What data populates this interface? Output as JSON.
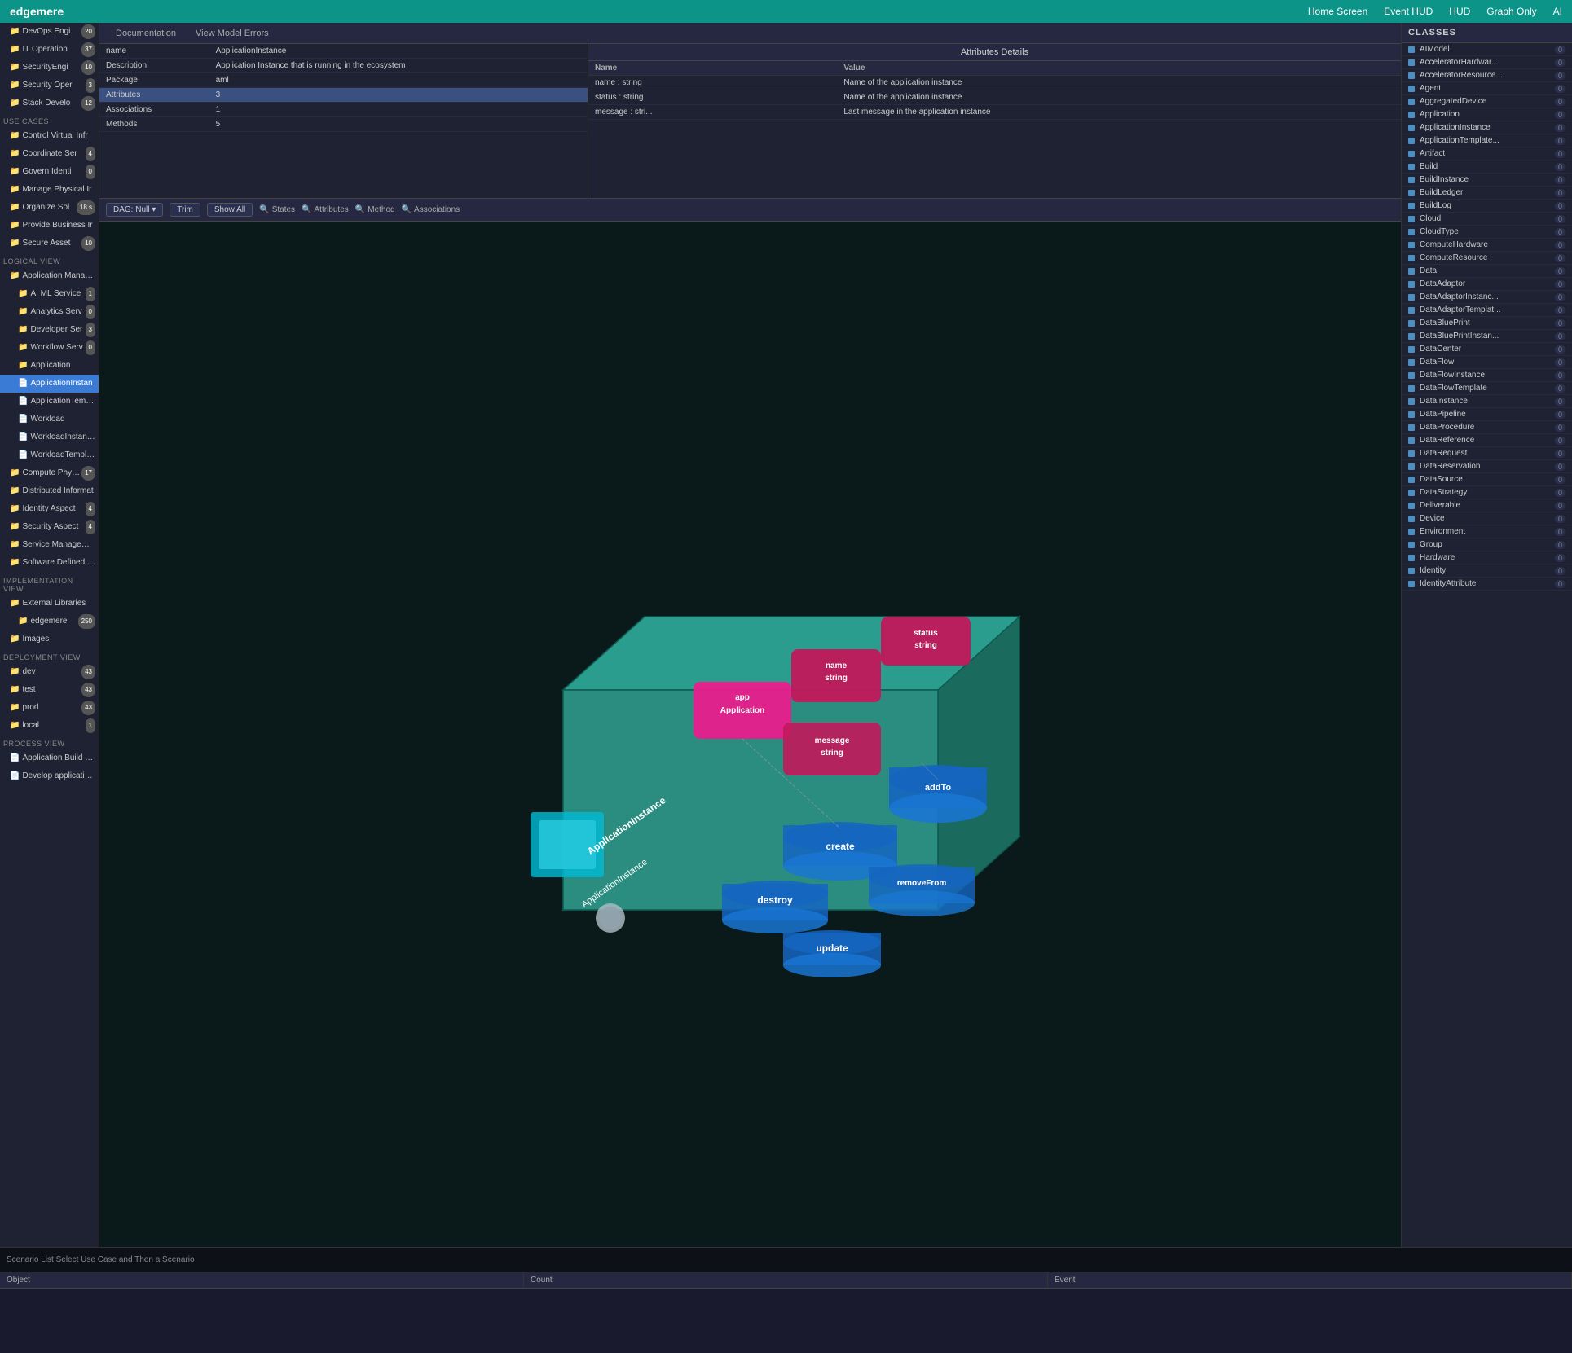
{
  "app": {
    "logo": "edgemere",
    "nav": [
      "Home Screen",
      "Event HUD",
      "HUD",
      "Graph Only",
      "AI"
    ]
  },
  "tabs": [
    {
      "label": "Documentation",
      "active": false
    },
    {
      "label": "View Model Errors",
      "active": false
    }
  ],
  "attributes_panel": {
    "title": "Attributes Details",
    "left_table": {
      "rows": [
        {
          "field": "name",
          "value": "ApplicationInstance"
        },
        {
          "field": "Description",
          "value": "Application Instance that is running in the ecosystem"
        },
        {
          "field": "Package",
          "value": "aml"
        },
        {
          "field": "Attributes",
          "value": "3",
          "highlight": true,
          "selected": true
        },
        {
          "field": "Associations",
          "value": "1"
        },
        {
          "field": "Methods",
          "value": "5"
        }
      ]
    },
    "right_table": {
      "cols": [
        "Name",
        "Value"
      ],
      "rows": [
        {
          "name": "name : string",
          "value": "Name of the application instance"
        },
        {
          "name": "status : string",
          "value": "Name of the application instance"
        },
        {
          "name": "message : stri...",
          "value": "Last message in the application instance"
        }
      ]
    }
  },
  "toolbar": {
    "dag_label": "DAG: Null ▾",
    "trim_label": "Trim",
    "show_all_label": "Show All",
    "states_label": "States",
    "attributes_label": "Attributes",
    "method_label": "Method",
    "associations_label": "Associations"
  },
  "viz": {
    "box_color": "#2a9d8f",
    "label": "ApplicationInstance",
    "app_label": "app\nApplication",
    "name_label": "name\nstring",
    "status_label": "status\nstring",
    "message_label": "message\nstring",
    "methods": [
      "addTo",
      "create",
      "removeFrom",
      "destroy",
      "update"
    ],
    "parent_label": "ApplicationInstance"
  },
  "classes_panel": {
    "header": "CLASSES",
    "items": [
      {
        "name": "AIModel",
        "count": 0
      },
      {
        "name": "AcceleratorHardwar...",
        "count": 0
      },
      {
        "name": "AcceleratorResource...",
        "count": 0
      },
      {
        "name": "Agent",
        "count": 0
      },
      {
        "name": "AggregatedDevice",
        "count": 0
      },
      {
        "name": "Application",
        "count": 0
      },
      {
        "name": "ApplicationInstance",
        "count": 0
      },
      {
        "name": "ApplicationTemplate...",
        "count": 0
      },
      {
        "name": "Artifact",
        "count": 0
      },
      {
        "name": "Build",
        "count": 0
      },
      {
        "name": "BuildInstance",
        "count": 0
      },
      {
        "name": "BuildLedger",
        "count": 0
      },
      {
        "name": "BuildLog",
        "count": 0
      },
      {
        "name": "Cloud",
        "count": 0
      },
      {
        "name": "CloudType",
        "count": 0
      },
      {
        "name": "ComputeHardware",
        "count": 0
      },
      {
        "name": "ComputeResource",
        "count": 0
      },
      {
        "name": "Data",
        "count": 0
      },
      {
        "name": "DataAdaptor",
        "count": 0
      },
      {
        "name": "DataAdaptorInstanc...",
        "count": 0
      },
      {
        "name": "DataAdaptorTemplat...",
        "count": 0
      },
      {
        "name": "DataBluePrint",
        "count": 0
      },
      {
        "name": "DataBluePrintInstan...",
        "count": 0
      },
      {
        "name": "DataCenter",
        "count": 0
      },
      {
        "name": "DataFlow",
        "count": 0
      },
      {
        "name": "DataFlowInstance",
        "count": 0
      },
      {
        "name": "DataFlowTemplate",
        "count": 0
      },
      {
        "name": "DataInstance",
        "count": 0
      },
      {
        "name": "DataPipeline",
        "count": 0
      },
      {
        "name": "DataProcedure",
        "count": 0
      },
      {
        "name": "DataReference",
        "count": 0
      },
      {
        "name": "DataRequest",
        "count": 0
      },
      {
        "name": "DataReservation",
        "count": 0
      },
      {
        "name": "DataSource",
        "count": 0
      },
      {
        "name": "DataStrategy",
        "count": 0
      },
      {
        "name": "Deliverable",
        "count": 0
      },
      {
        "name": "Device",
        "count": 0
      },
      {
        "name": "Environment",
        "count": 0
      },
      {
        "name": "Group",
        "count": 0
      },
      {
        "name": "Hardware",
        "count": 0
      },
      {
        "name": "Identity",
        "count": 0
      },
      {
        "name": "IdentityAttribute",
        "count": 0
      }
    ]
  },
  "sidebar": {
    "sections": [
      {
        "label": "",
        "items": [
          {
            "name": "DevOps Engi",
            "badge": "20",
            "indent": 1,
            "type": "folder"
          },
          {
            "name": "IT Operation",
            "badge": "37",
            "indent": 1,
            "type": "folder"
          },
          {
            "name": "SecurityEngi",
            "badge": "10",
            "indent": 1,
            "type": "folder"
          },
          {
            "name": "Security Oper",
            "badge": "3",
            "indent": 1,
            "type": "folder"
          },
          {
            "name": "Stack Develo",
            "badge": "12",
            "indent": 1,
            "type": "folder"
          }
        ]
      },
      {
        "label": "Use Cases",
        "items": [
          {
            "name": "Control Virtual Infr",
            "indent": 1,
            "type": "folder"
          },
          {
            "name": "Coordinate Ser",
            "badge": "4",
            "indent": 1,
            "type": "folder"
          },
          {
            "name": "Govern Identi",
            "badge": "0",
            "indent": 1,
            "type": "folder"
          },
          {
            "name": "Manage Physical Ir",
            "indent": 1,
            "type": "folder"
          },
          {
            "name": "Organize Sol",
            "badge": "18 s",
            "indent": 1,
            "type": "folder"
          },
          {
            "name": "Provide Business Ir",
            "indent": 1,
            "type": "folder"
          },
          {
            "name": "Secure Asset",
            "badge": "10",
            "indent": 1,
            "type": "folder"
          }
        ]
      },
      {
        "label": "LOGICAL VIEW",
        "items": [
          {
            "name": "Application Manageme",
            "indent": 1,
            "type": "folder"
          },
          {
            "name": "AI ML Service",
            "badge": "1",
            "indent": 2,
            "type": "folder"
          },
          {
            "name": "Analytics Serv",
            "badge": "0",
            "indent": 2,
            "type": "folder"
          },
          {
            "name": "Developer Ser",
            "badge": "3",
            "indent": 2,
            "type": "folder"
          },
          {
            "name": "Workflow Serv",
            "badge": "0",
            "indent": 2,
            "type": "folder"
          },
          {
            "name": "Application",
            "indent": 2,
            "type": "folder"
          },
          {
            "name": "ApplicationInstan",
            "indent": 2,
            "type": "page",
            "active": true
          },
          {
            "name": "ApplicationTemplat",
            "indent": 2,
            "type": "page"
          },
          {
            "name": "Workload",
            "indent": 2,
            "type": "page"
          },
          {
            "name": "WorkloadInstance",
            "indent": 2,
            "type": "page"
          },
          {
            "name": "WorkloadTemplate",
            "indent": 2,
            "type": "page"
          },
          {
            "name": "Compute Physical",
            "badge": "17",
            "indent": 1,
            "type": "folder"
          },
          {
            "name": "Distributed Informat",
            "indent": 1,
            "type": "folder"
          },
          {
            "name": "Identity Aspect",
            "badge": "4",
            "indent": 1,
            "type": "folder"
          },
          {
            "name": "Security Aspect",
            "badge": "4",
            "indent": 1,
            "type": "folder"
          },
          {
            "name": "Service Management",
            "indent": 1,
            "type": "folder"
          },
          {
            "name": "Software Defined Infr",
            "indent": 1,
            "type": "folder"
          }
        ]
      },
      {
        "label": "IMPLEMENTATION VIEW",
        "items": [
          {
            "name": "External Libraries",
            "indent": 1,
            "type": "folder"
          },
          {
            "name": "edgemere",
            "badge": "250",
            "indent": 2,
            "type": "folder"
          },
          {
            "name": "Images",
            "indent": 1,
            "type": "folder"
          }
        ]
      },
      {
        "label": "DEPLOYMENT VIEW",
        "items": [
          {
            "name": "dev",
            "badge": "43",
            "indent": 1,
            "type": "folder"
          },
          {
            "name": "test",
            "badge": "43",
            "indent": 1,
            "type": "folder"
          },
          {
            "name": "prod",
            "badge": "43",
            "indent": 1,
            "type": "folder"
          },
          {
            "name": "local",
            "badge": "1",
            "indent": 1,
            "type": "folder"
          }
        ]
      },
      {
        "label": "PROCESS VIEW",
        "items": [
          {
            "name": "Application Build Proc",
            "indent": 1,
            "type": "page"
          },
          {
            "name": "Develop application P",
            "indent": 1,
            "type": "page"
          }
        ]
      }
    ]
  },
  "statusbar": {
    "text": "Scenario List Select Use Case and Then a Scenario"
  },
  "bottom_table": {
    "cols": [
      "Object",
      "Count",
      "Event"
    ],
    "rows": []
  }
}
